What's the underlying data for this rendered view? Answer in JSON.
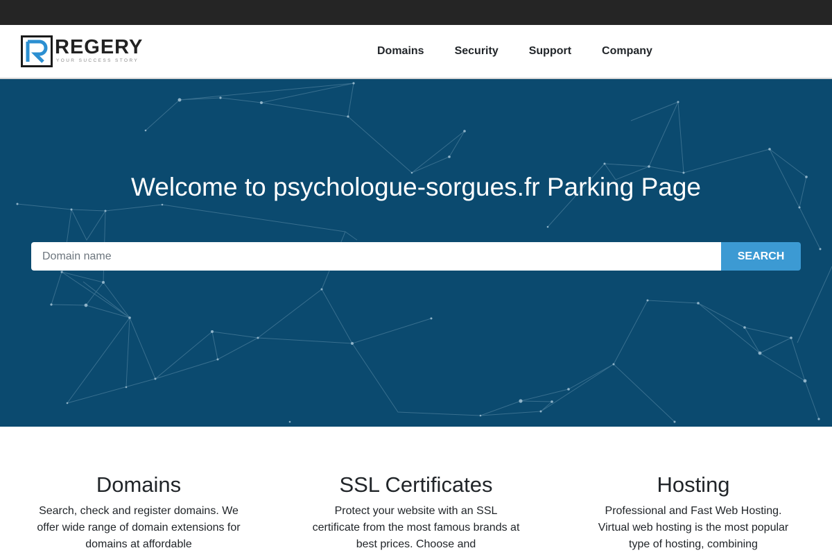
{
  "brand": {
    "name": "REGERY",
    "tagline": "YOUR SUCCESS STORY",
    "colors": {
      "accent": "#3c9ad3",
      "hero_bg": "#0b4a6f",
      "topbar": "#252525"
    }
  },
  "nav": {
    "items": [
      {
        "label": "Domains"
      },
      {
        "label": "Security"
      },
      {
        "label": "Support"
      },
      {
        "label": "Company"
      }
    ]
  },
  "hero": {
    "title": "Welcome to psychologue-sorgues.fr Parking Page",
    "search": {
      "placeholder": "Domain name",
      "value": "",
      "button_label": "SEARCH"
    }
  },
  "features": [
    {
      "title": "Domains",
      "text": "Search, check and register domains. We offer wide range of domain extensions for domains at affordable"
    },
    {
      "title": "SSL Certificates",
      "text": "Protect your website with an SSL certificate from the most famous brands at best prices. Choose and"
    },
    {
      "title": "Hosting",
      "text": "Professional and Fast Web Hosting. Virtual web hosting is the most popular type of hosting, combining"
    }
  ]
}
